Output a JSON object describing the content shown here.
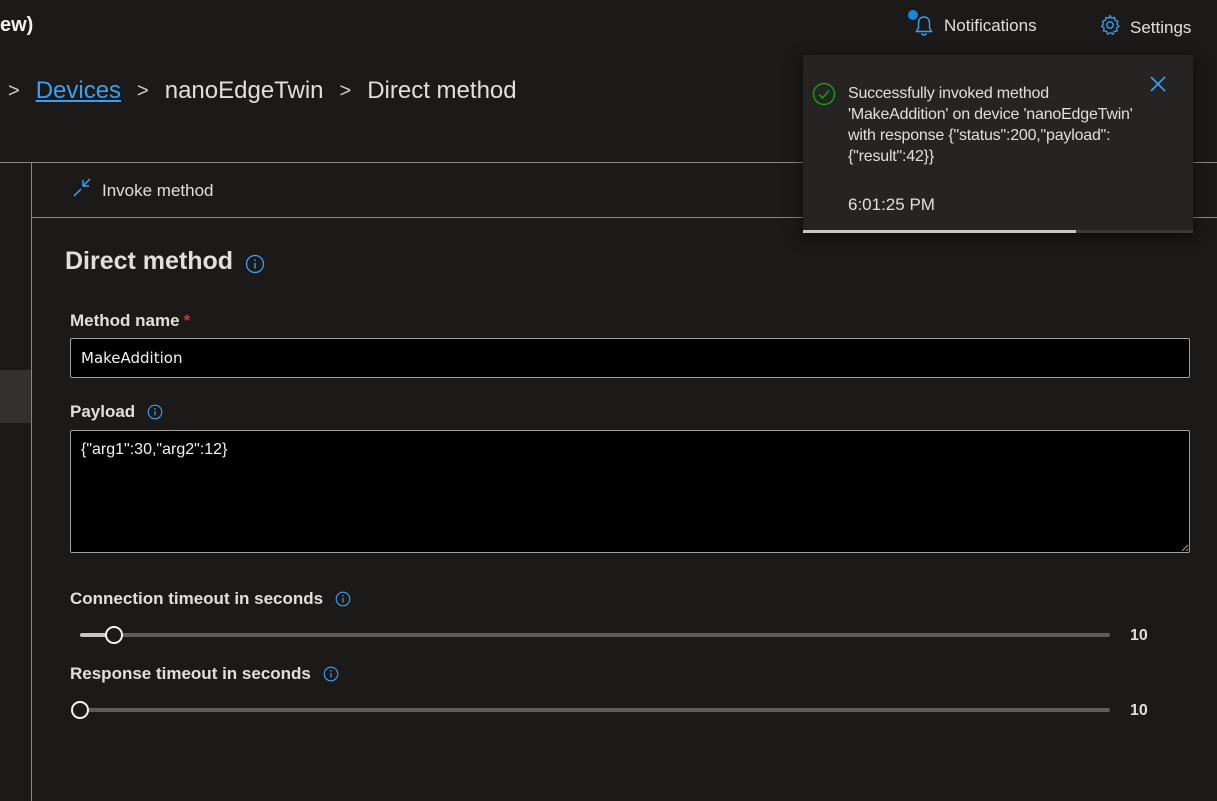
{
  "header": {
    "title_fragment": "ew)",
    "notifications_label": "Notifications",
    "settings_label": "Settings"
  },
  "breadcrumb": {
    "separator": ">",
    "items": [
      "Devices",
      "nanoEdgeTwin",
      "Direct method"
    ]
  },
  "command_bar": {
    "invoke_label": "Invoke method"
  },
  "form": {
    "title": "Direct method",
    "method_name_label": "Method name",
    "required_mark": "*",
    "method_name_value": "MakeAddition",
    "payload_label": "Payload",
    "payload_value": "{\"arg1\":30,\"arg2\":12}",
    "connection_timeout_label": "Connection timeout in seconds",
    "connection_timeout_value": "10",
    "connection_timeout_fraction": 0.033,
    "response_timeout_label": "Response timeout in seconds",
    "response_timeout_value": "10",
    "response_timeout_fraction": 0.0
  },
  "toast": {
    "message": "Successfully invoked method 'MakeAddition' on device 'nanoEdgeTwin' with response {\"status\":200,\"payload\":{\"result\":42}}",
    "time": "6:01:25 PM",
    "progress_fraction": 0.7
  },
  "colors": {
    "accent": "#3aa0f3",
    "success": "#107c10",
    "required": "#d13438",
    "notification_dot": "#1a86d9"
  },
  "icons": {
    "bell": "bell-icon",
    "gear": "gear-icon",
    "invoke": "invoke-method-icon",
    "info": "info-icon",
    "check": "check-circle-icon",
    "close": "close-icon"
  }
}
